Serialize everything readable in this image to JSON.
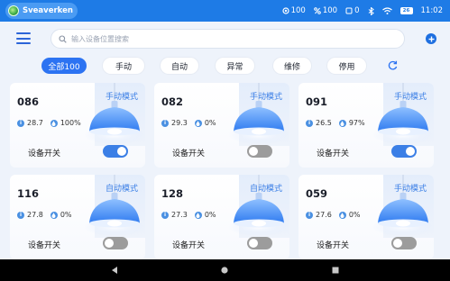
{
  "statusbar": {
    "app_name": "Sveaverken",
    "stat1": "100",
    "stat2": "100",
    "stat3": "0",
    "battery": "26",
    "time": "11:02"
  },
  "search": {
    "placeholder": "输入设备位置搜索",
    "value": ""
  },
  "tabs": [
    {
      "label": "全部100",
      "active": true
    },
    {
      "label": "手动",
      "active": false
    },
    {
      "label": "自动",
      "active": false
    },
    {
      "label": "异常",
      "active": false
    },
    {
      "label": "维修",
      "active": false
    },
    {
      "label": "停用",
      "active": false
    }
  ],
  "switch_label": "设备开关",
  "devices": [
    {
      "id": "086",
      "mode": "手动模式",
      "temp": "28.7",
      "humidity": "100%",
      "on": true
    },
    {
      "id": "082",
      "mode": "手动模式",
      "temp": "29.3",
      "humidity": "0%",
      "on": false
    },
    {
      "id": "091",
      "mode": "手动模式",
      "temp": "26.5",
      "humidity": "97%",
      "on": true
    },
    {
      "id": "116",
      "mode": "自动模式",
      "temp": "27.8",
      "humidity": "0%",
      "on": false
    },
    {
      "id": "128",
      "mode": "自动模式",
      "temp": "27.3",
      "humidity": "0%",
      "on": false
    },
    {
      "id": "059",
      "mode": "手动模式",
      "temp": "27.6",
      "humidity": "0%",
      "on": false
    }
  ],
  "colors": {
    "accent": "#2c73f2",
    "statusbar": "#1e7be6",
    "toggle_on": "#3b7fe6",
    "toggle_off": "#9c9c9c"
  },
  "icons": {
    "menu": "hamburger-icon",
    "search": "search-icon",
    "add": "plus-icon",
    "refresh": "refresh-icon",
    "temperature": "info-icon",
    "humidity": "droplet-icon",
    "lamp": "pendant-lamp-icon"
  }
}
